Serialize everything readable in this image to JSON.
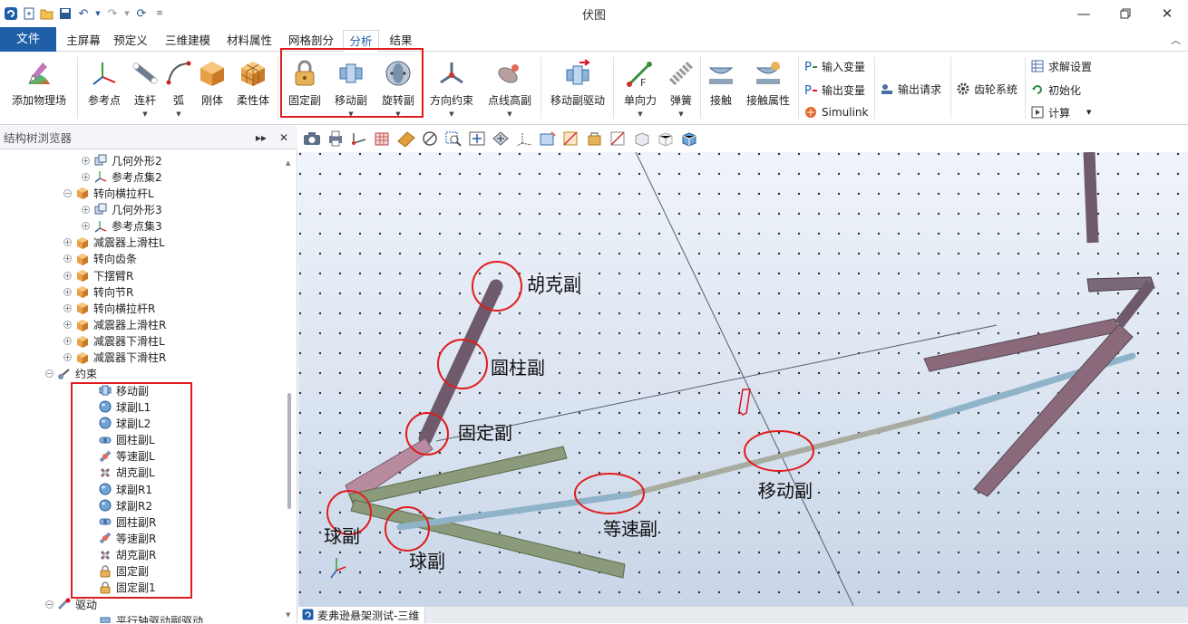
{
  "window": {
    "title": "伏图"
  },
  "ribbon_tabs": [
    {
      "label": "文件"
    },
    {
      "label": "主屏幕"
    },
    {
      "label": "预定义"
    },
    {
      "label": "三维建模"
    },
    {
      "label": "材料属性"
    },
    {
      "label": "网格剖分"
    },
    {
      "label": "分析"
    },
    {
      "label": "结果"
    }
  ],
  "ribbon": {
    "add_physics": "添加物理场",
    "ref_point": "参考点",
    "link": "连杆",
    "arc": "弧",
    "rigid": "刚体",
    "flexible": "柔性体",
    "fixed_joint": "固定副",
    "prismatic_joint": "移动副",
    "revolute_joint": "旋转副",
    "orientation": "方向约束",
    "curve_cam": "点线高副",
    "prismatic_drive": "移动副驱动",
    "single_force": "单向力",
    "spring": "弹簧",
    "contact": "接触",
    "contact_props": "接触属性",
    "input_var": "输入变量",
    "output_var": "输出变量",
    "simulink": "Simulink",
    "output_request": "输出请求",
    "gear_system": "齿轮系统",
    "solve_settings": "求解设置",
    "initialize": "初始化",
    "compute": "计算"
  },
  "panel": {
    "title": "结构树浏览器"
  },
  "tree": [
    {
      "label": "几何外形2",
      "icon": "geometry-icon",
      "expand": "+"
    },
    {
      "label": "参考点集2",
      "icon": "axes-icon",
      "expand": "+"
    },
    {
      "label": "转向横拉杆L",
      "icon": "body-cube-icon",
      "expand": "-"
    },
    {
      "label": "几何外形3",
      "icon": "geometry-icon",
      "expand": "+"
    },
    {
      "label": "参考点集3",
      "icon": "axes-icon",
      "expand": "+"
    },
    {
      "label": "减震器上滑柱L",
      "icon": "body-cube-icon",
      "expand": "+"
    },
    {
      "label": "转向齿条",
      "icon": "body-cube-icon",
      "expand": "+"
    },
    {
      "label": "下摆臂R",
      "icon": "body-cube-icon",
      "expand": "+"
    },
    {
      "label": "转向节R",
      "icon": "body-cube-icon",
      "expand": "+"
    },
    {
      "label": "转向横拉杆R",
      "icon": "body-cube-icon",
      "expand": "+"
    },
    {
      "label": "减震器上滑柱R",
      "icon": "body-cube-icon",
      "expand": "+"
    },
    {
      "label": "减震器下滑柱L",
      "icon": "body-cube-icon",
      "expand": "+"
    },
    {
      "label": "减震器下滑柱R",
      "icon": "body-cube-icon",
      "expand": "+"
    },
    {
      "label": "约束",
      "icon": "constraint-icon",
      "expand": "-"
    },
    {
      "label": "移动副",
      "icon": "prismatic-joint-icon"
    },
    {
      "label": "球副L1",
      "icon": "spherical-joint-icon"
    },
    {
      "label": "球副L2",
      "icon": "spherical-joint-icon"
    },
    {
      "label": "圆柱副L",
      "icon": "cylindrical-joint-icon"
    },
    {
      "label": "等速副L",
      "icon": "cv-joint-icon"
    },
    {
      "label": "胡克副L",
      "icon": "hooke-joint-icon"
    },
    {
      "label": "球副R1",
      "icon": "spherical-joint-icon"
    },
    {
      "label": "球副R2",
      "icon": "spherical-joint-icon"
    },
    {
      "label": "圆柱副R",
      "icon": "cylindrical-joint-icon"
    },
    {
      "label": "等速副R",
      "icon": "cv-joint-icon"
    },
    {
      "label": "胡克副R",
      "icon": "hooke-joint-icon"
    },
    {
      "label": "固定副",
      "icon": "lock-icon"
    },
    {
      "label": "固定副1",
      "icon": "lock-icon"
    },
    {
      "label": "驱动",
      "icon": "drive-icon",
      "expand": "-"
    },
    {
      "label": "平行轴驱动副驱动",
      "icon": "drive-item-icon"
    }
  ],
  "annotations": {
    "hooke": "胡克副",
    "cylindrical": "圆柱副",
    "fixed": "固定副",
    "ball_left": "球副",
    "ball_right": "球副",
    "cv": "等速副",
    "prismatic": "移动副"
  },
  "viewport_tab": "麦弗逊悬架测试-三维",
  "colors": {
    "accent": "#1e5fa8",
    "highlight": "#e01c1c",
    "link_dark": "#6e5a6a",
    "link_green": "#8a9a7a",
    "rod_blue": "#8fb3c9"
  }
}
